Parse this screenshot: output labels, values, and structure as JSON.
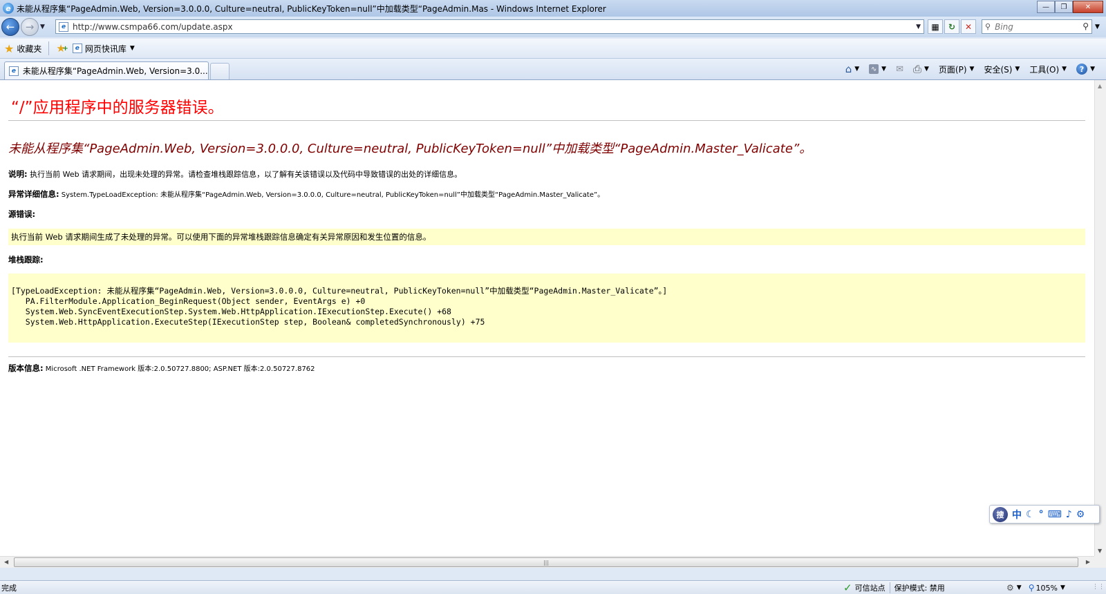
{
  "window": {
    "title": "未能从程序集“PageAdmin.Web, Version=3.0.0.0, Culture=neutral, PublicKeyToken=null”中加载类型“PageAdmin.Mas - Windows Internet Explorer",
    "minimize": "0",
    "maximize": "1",
    "close": "X"
  },
  "address_bar": {
    "url": "http://www.csmpa66.com/update.aspx",
    "search_placeholder": "Bing"
  },
  "favorites_bar": {
    "favorites_label": "收藏夹",
    "web_slice_label": "网页快讯库"
  },
  "tab": {
    "title": "未能从程序集“PageAdmin.Web, Version=3.0...."
  },
  "command_bar": {
    "page": "页面(P)",
    "safety": "安全(S)",
    "tools": "工具(O)"
  },
  "page": {
    "heading": "“/”应用程序中的服务器错误。",
    "error_message": "未能从程序集“PageAdmin.Web, Version=3.0.0.0, Culture=neutral, PublicKeyToken=null”中加载类型“PageAdmin.Master_Valicate”。",
    "description_label": "说明:",
    "description_text": " 执行当前 Web 请求期间，出现未处理的异常。请检查堆栈跟踪信息，以了解有关该错误以及代码中导致错误的出处的详细信息。",
    "exception_label": "异常详细信息:",
    "exception_text": " System.TypeLoadException: 未能从程序集“PageAdmin.Web, Version=3.0.0.0, Culture=neutral, PublicKeyToken=null”中加载类型“PageAdmin.Master_Valicate”。",
    "source_error_label": "源错误:",
    "source_error_text": "执行当前 Web 请求期间生成了未处理的异常。可以使用下面的异常堆栈跟踪信息确定有关异常原因和发生位置的信息。",
    "stack_trace_label": "堆栈跟踪:",
    "stack_trace": [
      "[TypeLoadException: 未能从程序集“PageAdmin.Web, Version=3.0.0.0, Culture=neutral, PublicKeyToken=null”中加载类型“PageAdmin.Master_Valicate”。]",
      "   PA.FilterModule.Application_BeginRequest(Object sender, EventArgs e) +0",
      "   System.Web.SyncEventExecutionStep.System.Web.HttpApplication.IExecutionStep.Execute() +68",
      "   System.Web.HttpApplication.ExecuteStep(IExecutionStep step, Boolean& completedSynchronously) +75"
    ],
    "version_label": "版本信息:",
    "version_text": " Microsoft .NET Framework 版本:2.0.50727.8800; ASP.NET 版本:2.0.50727.8762"
  },
  "ime": {
    "logo": "搜",
    "mode": "中"
  },
  "status_bar": {
    "status": "完成",
    "zone": "可信站点",
    "protected_mode": "保护模式: 禁用",
    "zoom": "105%"
  }
}
